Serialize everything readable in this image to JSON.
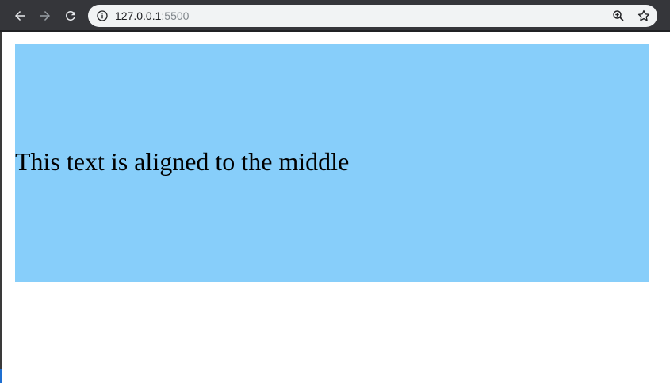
{
  "browser": {
    "url": {
      "host": "127.0.0.1",
      "port": ":5500"
    },
    "icons": {
      "back": "arrow-left-icon",
      "forward": "arrow-right-icon",
      "reload": "reload-icon",
      "info": "info-icon",
      "zoom": "zoom-in-icon",
      "bookmark": "star-icon"
    }
  },
  "content": {
    "text": "This text is aligned to the middle",
    "background": "#87cefa"
  },
  "colors": {
    "toolbar": "#35363a",
    "omnibox": "#f1f3f4"
  }
}
